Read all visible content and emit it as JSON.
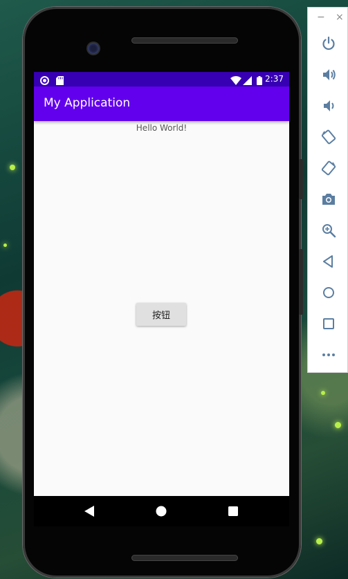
{
  "status_bar": {
    "time": "2:37"
  },
  "app_bar": {
    "title": "My Application"
  },
  "content": {
    "hello_text": "Hello World!",
    "button_label": "按钮"
  },
  "emulator_panel": {
    "minimize_label": "−",
    "close_label": "×",
    "controls": [
      "power-icon",
      "volume-up-icon",
      "volume-down-icon",
      "rotate-left-icon",
      "rotate-right-icon",
      "screenshot-icon",
      "zoom-icon",
      "back-icon",
      "home-icon",
      "overview-icon",
      "more-icon"
    ]
  },
  "colors": {
    "status_bar": "#3700b3",
    "app_bar": "#6200ee",
    "screen_bg": "#fafafa",
    "panel_icon": "#5b7ea1"
  }
}
